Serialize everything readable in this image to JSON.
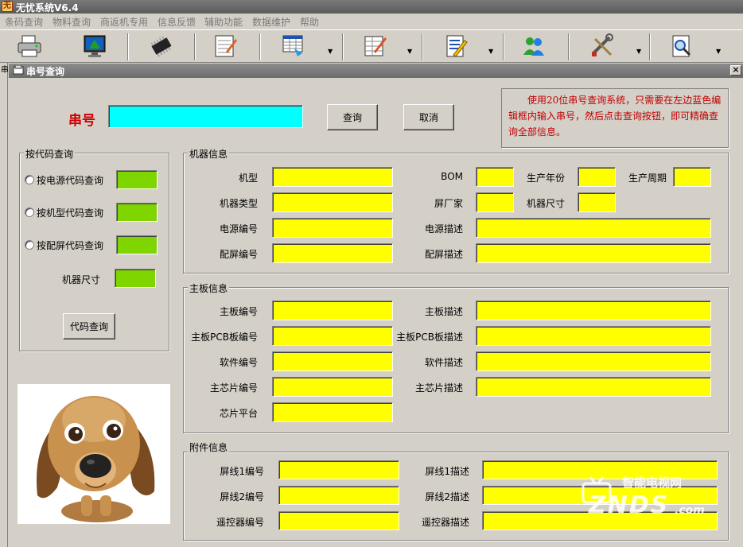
{
  "window": {
    "title": "无忧系统V6.4",
    "app_icon_char": "无"
  },
  "menu": [
    "条码查询",
    "物料查询",
    "商返机专用",
    "信息反馈",
    "辅助功能",
    "数据维护",
    "帮助"
  ],
  "toolbar": {
    "buttons": [
      "printer-icon",
      "monitor-icon",
      "chip-icon",
      "form-edit-icon",
      "table-import-icon",
      "sheet-edit-icon",
      "checklist-pencil-icon",
      "users-icon",
      "tools-icon",
      "search-doc-icon"
    ]
  },
  "left_strip_char": "串",
  "child_window": {
    "title": "串号查询",
    "close_label": "×"
  },
  "serial": {
    "label": "串号",
    "value": "",
    "query_label": "查询",
    "cancel_label": "取消"
  },
  "info_text": "使用20位串号查询系统，只需要在左边蓝色编辑框内输入串号，然后点击查询按钮，即可精确查询全部信息。",
  "code_query": {
    "title": "按代码查询",
    "options": [
      "按电源代码查询",
      "按机型代码查询",
      "按配屏代码查询"
    ],
    "size_label": "机器尺寸",
    "button_label": "代码查询"
  },
  "machine_info": {
    "title": "机器信息",
    "model": "机型",
    "bom": "BOM",
    "prod_year": "生产年份",
    "prod_cycle": "生产周期",
    "machine_type": "机器类型",
    "panel_maker": "屏厂家",
    "machine_size": "机器尺寸",
    "power_code": "电源编号",
    "power_desc": "电源描述",
    "panel_code": "配屏编号",
    "panel_desc": "配屏描述"
  },
  "board_info": {
    "title": "主板信息",
    "board_code": "主板编号",
    "board_desc": "主板描述",
    "pcb_code": "主板PCB板编号",
    "pcb_desc": "主板PCB板描述",
    "sw_code": "软件编号",
    "sw_desc": "软件描述",
    "chip_code": "主芯片编号",
    "chip_desc": "主芯片描述",
    "chip_platform": "芯片平台"
  },
  "accessory_info": {
    "title": "附件信息",
    "cable1_code": "屏线1编号",
    "cable1_desc": "屏线1描述",
    "cable2_code": "屏线2编号",
    "cable2_desc": "屏线2描述",
    "remote_code": "遥控器编号",
    "remote_desc": "遥控器描述"
  },
  "watermark": {
    "line1": "智能电视网",
    "line2": "ZNDS",
    "line3": ".com"
  }
}
